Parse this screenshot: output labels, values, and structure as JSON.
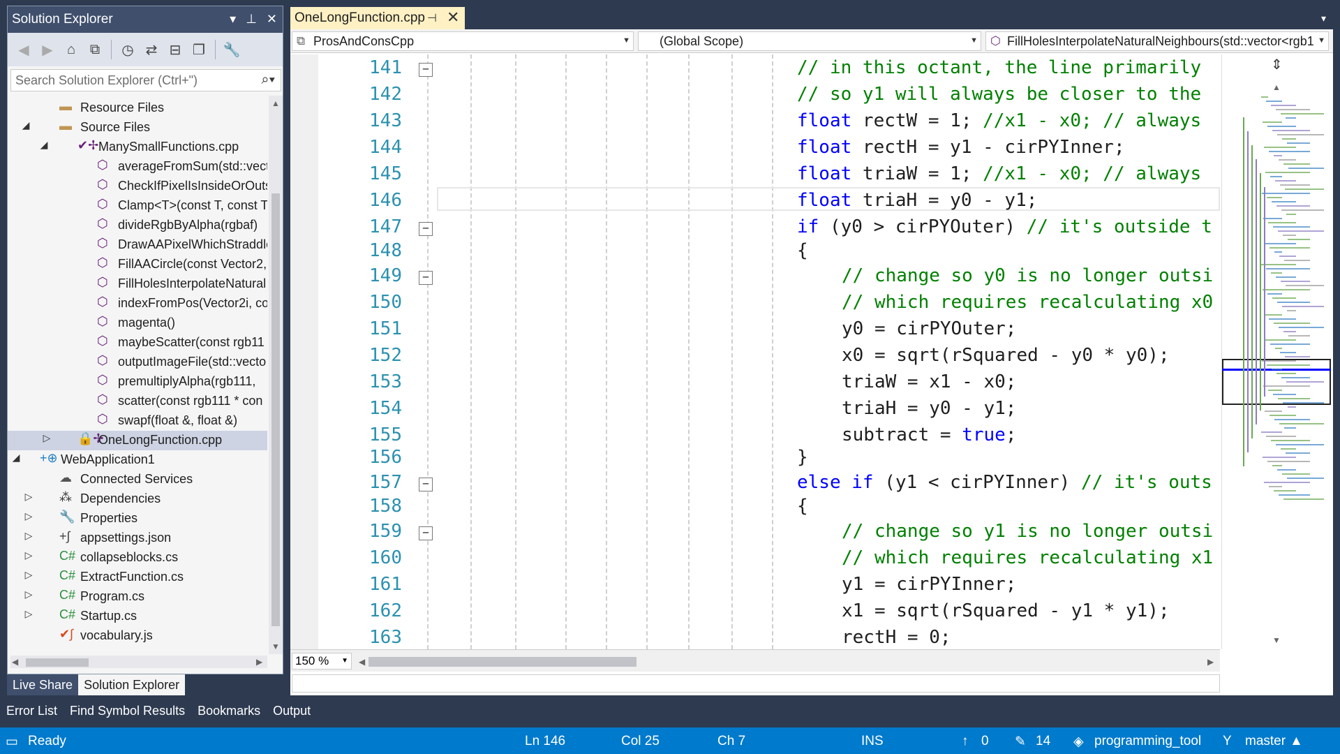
{
  "solution_explorer": {
    "title": "Solution Explorer",
    "search_placeholder": "Search Solution Explorer (Ctrl+\")",
    "tree": [
      {
        "label": "Resource Files"
      },
      {
        "label": "Source Files"
      },
      {
        "label": "ManySmallFunctions.cpp"
      },
      {
        "label": "averageFromSum(std::vect"
      },
      {
        "label": "CheckIfPixelIsInsideOrOuts"
      },
      {
        "label": "Clamp<T>(const T, const T"
      },
      {
        "label": "divideRgbByAlpha(rgbaf)"
      },
      {
        "label": "DrawAAPixelWhichStraddle"
      },
      {
        "label": "FillAACircle(const Vector2,"
      },
      {
        "label": "FillHolesInterpolateNatural"
      },
      {
        "label": "indexFromPos(Vector2i, co"
      },
      {
        "label": "magenta()"
      },
      {
        "label": "maybeScatter(const rgb11"
      },
      {
        "label": "outputImageFile(std::vecto"
      },
      {
        "label": "premultiplyAlpha(rgb111, "
      },
      {
        "label": "scatter(const rgb111 * con"
      },
      {
        "label": "swapf(float &, float &)"
      },
      {
        "label": "OneLongFunction.cpp"
      },
      {
        "label": "WebApplication1"
      },
      {
        "label": "Connected Services"
      },
      {
        "label": "Dependencies"
      },
      {
        "label": "Properties"
      },
      {
        "label": "appsettings.json"
      },
      {
        "label": "collapseblocks.cs"
      },
      {
        "label": "ExtractFunction.cs"
      },
      {
        "label": "Program.cs"
      },
      {
        "label": "Startup.cs"
      },
      {
        "label": "vocabulary.js"
      }
    ]
  },
  "left_tabs": [
    "Live Share",
    "Solution Explorer"
  ],
  "tool_tabs": [
    "Error List",
    "Find Symbol Results",
    "Bookmarks",
    "Output"
  ],
  "editor": {
    "tab_label": "OneLongFunction.cpp",
    "nav": {
      "project": "ProsAndConsCpp",
      "scope": "(Global Scope)",
      "member": "FillHolesInterpolateNaturalNeighbours(std::vector<rgb1"
    },
    "zoom": "150 %",
    "lines": [
      {
        "n": "141",
        "indent": 0,
        "tokens": [
          {
            "t": "// in this octant, the line primarily",
            "c": "cm"
          }
        ]
      },
      {
        "n": "142",
        "indent": 0,
        "tokens": [
          {
            "t": "// so y1 will always be closer to the",
            "c": "cm"
          }
        ]
      },
      {
        "n": "143",
        "indent": 0,
        "tokens": [
          {
            "t": "float",
            "c": "kw"
          },
          {
            "t": " rectW = 1; ",
            "c": ""
          },
          {
            "t": "//x1 - x0; // always",
            "c": "cm"
          }
        ]
      },
      {
        "n": "144",
        "indent": 0,
        "tokens": [
          {
            "t": "float",
            "c": "kw"
          },
          {
            "t": " rectH = y1 - cirPYInner;",
            "c": ""
          }
        ]
      },
      {
        "n": "145",
        "indent": 0,
        "tokens": [
          {
            "t": "float",
            "c": "kw"
          },
          {
            "t": " triaW = 1; ",
            "c": ""
          },
          {
            "t": "//x1 - x0; // always",
            "c": "cm"
          }
        ]
      },
      {
        "n": "146",
        "indent": 0,
        "tokens": [
          {
            "t": "float",
            "c": "kw"
          },
          {
            "t": " triaH = y0 - y1;",
            "c": ""
          }
        ]
      },
      {
        "n": "147",
        "indent": 0,
        "tokens": [
          {
            "t": "if",
            "c": "kw"
          },
          {
            "t": " (y0 > cirPYOuter) ",
            "c": ""
          },
          {
            "t": "// it's outside t",
            "c": "cm"
          }
        ]
      },
      {
        "n": "148",
        "indent": 0,
        "tokens": [
          {
            "t": "{",
            "c": ""
          }
        ]
      },
      {
        "n": "149",
        "indent": 1,
        "tokens": [
          {
            "t": "// change so y0 is no longer outsi",
            "c": "cm"
          }
        ]
      },
      {
        "n": "150",
        "indent": 1,
        "tokens": [
          {
            "t": "// which requires recalculating x0",
            "c": "cm"
          }
        ]
      },
      {
        "n": "151",
        "indent": 1,
        "tokens": [
          {
            "t": "y0 = cirPYOuter;",
            "c": ""
          }
        ]
      },
      {
        "n": "152",
        "indent": 1,
        "tokens": [
          {
            "t": "x0 = sqrt(rSquared - y0 * y0);",
            "c": ""
          }
        ]
      },
      {
        "n": "153",
        "indent": 1,
        "tokens": [
          {
            "t": "triaW = x1 - x0;",
            "c": ""
          }
        ]
      },
      {
        "n": "154",
        "indent": 1,
        "tokens": [
          {
            "t": "triaH = y0 - y1;",
            "c": ""
          }
        ]
      },
      {
        "n": "155",
        "indent": 1,
        "tokens": [
          {
            "t": "subtract = ",
            "c": ""
          },
          {
            "t": "true",
            "c": "kw"
          },
          {
            "t": ";",
            "c": ""
          }
        ]
      },
      {
        "n": "156",
        "indent": 0,
        "tokens": [
          {
            "t": "}",
            "c": ""
          }
        ]
      },
      {
        "n": "157",
        "indent": 0,
        "tokens": [
          {
            "t": "else if",
            "c": "kw"
          },
          {
            "t": " (y1 < cirPYInner) ",
            "c": ""
          },
          {
            "t": "// it's outs",
            "c": "cm"
          }
        ]
      },
      {
        "n": "158",
        "indent": 0,
        "tokens": [
          {
            "t": "{",
            "c": ""
          }
        ]
      },
      {
        "n": "159",
        "indent": 1,
        "tokens": [
          {
            "t": "// change so y1 is no longer outsi",
            "c": "cm"
          }
        ]
      },
      {
        "n": "160",
        "indent": 1,
        "tokens": [
          {
            "t": "// which requires recalculating x1",
            "c": "cm"
          }
        ]
      },
      {
        "n": "161",
        "indent": 1,
        "tokens": [
          {
            "t": "y1 = cirPYInner;",
            "c": ""
          }
        ]
      },
      {
        "n": "162",
        "indent": 1,
        "tokens": [
          {
            "t": "x1 = sqrt(rSquared - y1 * y1);",
            "c": ""
          }
        ]
      },
      {
        "n": "163",
        "indent": 1,
        "tokens": [
          {
            "t": "rectH = 0;",
            "c": ""
          }
        ]
      }
    ]
  },
  "status": {
    "ready": "Ready",
    "ln": "Ln 146",
    "col": "Col 25",
    "ch": "Ch 7",
    "ins": "INS",
    "push": "0",
    "edits": "14",
    "repo": "programming_tool",
    "branch": "master"
  },
  "colors": {
    "status_bar": "#007acc",
    "keyword": "#0000ff",
    "comment": "#008000",
    "line_number": "#2b91af",
    "active_tab": "#fff1c4"
  }
}
